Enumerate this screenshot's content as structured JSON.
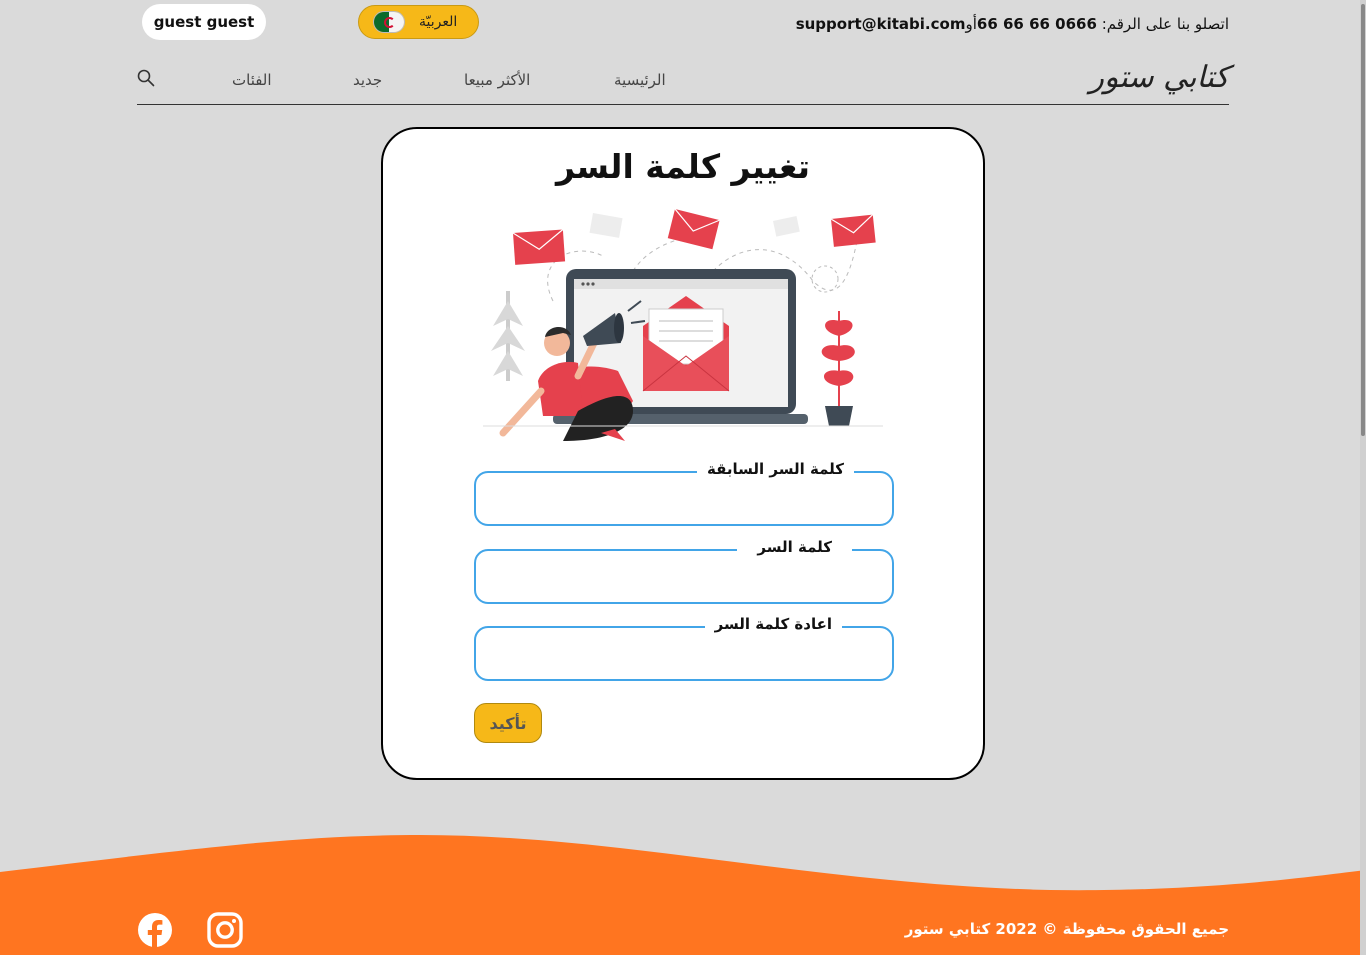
{
  "header": {
    "user_label": "guest guest",
    "language_label": "العربيّة",
    "contact_prefix": "اتصلو بنا على الرقم:",
    "contact_phone": "66 66 66 0666",
    "contact_or": "أو",
    "contact_email": "support@kitabi.com"
  },
  "nav": {
    "logo": "كتابي ستور",
    "items": [
      {
        "label": "الرئيسية"
      },
      {
        "label": "الأكثر مبيعا"
      },
      {
        "label": "جديد"
      },
      {
        "label": "الفئات"
      }
    ]
  },
  "form": {
    "title": "تغيير كلمة السر",
    "fields": [
      {
        "label": "كلمة السر السابقة",
        "value": "",
        "placeholder": ""
      },
      {
        "label": "كلمة السر",
        "value": "",
        "placeholder": ""
      },
      {
        "label": "اعادة كلمة السر",
        "value": "",
        "placeholder": ""
      }
    ],
    "submit_label": "تأكيد"
  },
  "footer": {
    "copyright": "جميع الحقوق محفوظة © 2022 كتابي ستور",
    "social": [
      "facebook-icon",
      "instagram-icon"
    ]
  },
  "colors": {
    "accent": "#f6b818",
    "footer": "#ff7520",
    "field_border": "#42a5e8",
    "illustration_red": "#e5414d"
  }
}
